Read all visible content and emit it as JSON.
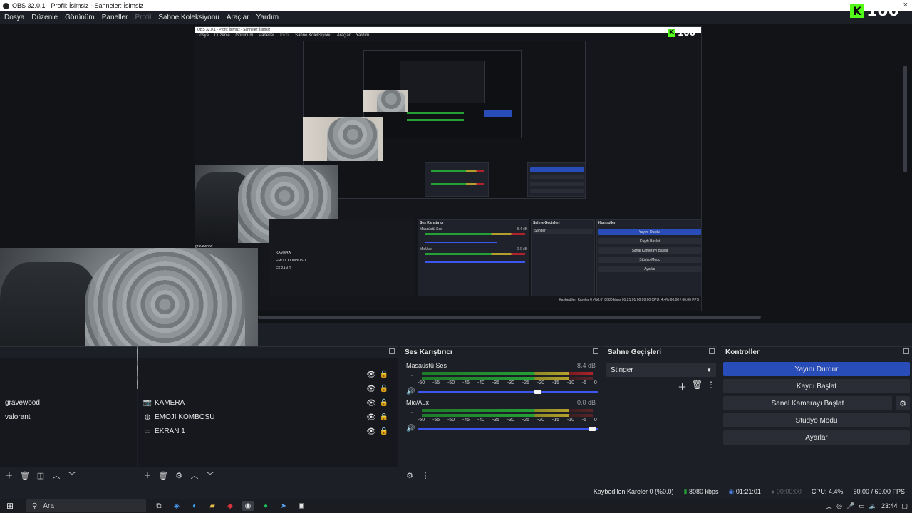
{
  "window": {
    "title": "OBS 32.0.1 - Profil: İsimsiz - Sahneler: İsimsiz",
    "close_glyph": "×"
  },
  "menu": [
    "Dosya",
    "Düzenle",
    "Görünüm",
    "Paneller",
    "Profil",
    "Sahne Koleksiyonu",
    "Araçlar",
    "Yardım"
  ],
  "kick": {
    "count": "100",
    "badge": "K"
  },
  "scenes_dock": {
    "items": [
      "gravewood",
      "valorant"
    ]
  },
  "sources_dock": {
    "items": [
      {
        "label": "KAMERA",
        "icon": "camera-icon"
      },
      {
        "label": "EMOJI KOMBOSU",
        "icon": "browser-icon"
      },
      {
        "label": "EKRAN 1",
        "icon": "monitor-icon"
      }
    ]
  },
  "mixer": {
    "title": "Ses Karıştırıcı",
    "scale": [
      "-60",
      "-55",
      "-50",
      "-45",
      "-40",
      "-35",
      "-30",
      "-25",
      "-20",
      "-15",
      "-10",
      "-5",
      "0"
    ],
    "channels": [
      {
        "name": "Masaüstü Ses",
        "db": "-8.4 dB",
        "volume": 0.68
      },
      {
        "name": "Mic/Aux",
        "db": "0.0 dB",
        "volume": 1.0
      }
    ]
  },
  "transitions": {
    "title": "Sahne Geçişleri",
    "selected": "Stinger"
  },
  "controls": {
    "title": "Kontroller",
    "stop_stream": "Yayını Durdur",
    "start_record": "Kaydı Başlat",
    "start_virtualcam": "Sanal Kamerayı Başlat",
    "studio_mode": "Stüdyo Modu",
    "settings": "Ayarlar"
  },
  "status": {
    "dropped_frames": "Kaybedilen Kareler 0 (%0.0)",
    "bitrate": "8080 kbps",
    "stream_time": "01:21:01",
    "record_time": "00:00:00",
    "cpu": "CPU: 4.4%",
    "fps": "60.00 / 60.00 FPS"
  },
  "taskbar": {
    "search_placeholder": "Ara",
    "clock": "23:44"
  },
  "nested": {
    "title": "OBS 32.0.1 - Profil: İsimsiz - Sahneler: İsimsiz",
    "menu": [
      "Dosya",
      "Düzenle",
      "Görünüm",
      "Paneller",
      "Profil",
      "Sahne Koleksiyonu",
      "Araçlar",
      "Yardım"
    ],
    "kick_count": "100",
    "scene_item": "gravewood",
    "sources": [
      "KAMERA",
      "EMOJI KOMBOSU",
      "EKRAN 1"
    ],
    "mixer_title": "Ses Karıştırıcı",
    "ch1": "Masaüstü Ses",
    "ch1_db": "-8.4 dB",
    "ch2": "Mic/Aux",
    "ch2_db": "0.0 dB",
    "transitions_title": "Sahne Geçişleri",
    "transition": "Stinger",
    "controls_title": "Kontroller",
    "btns": [
      "Yayını Durdur",
      "Kaydı Başlat",
      "Sanal Kamerayı Başlat",
      "Stüdyo Modu",
      "Ayarlar"
    ],
    "status": "Kaybedilen Kareler 0 (%0.0)  8080 kbps  01:21:01  00:00:00  CPU: 4.4%  60.00 / 60.00 FPS"
  }
}
